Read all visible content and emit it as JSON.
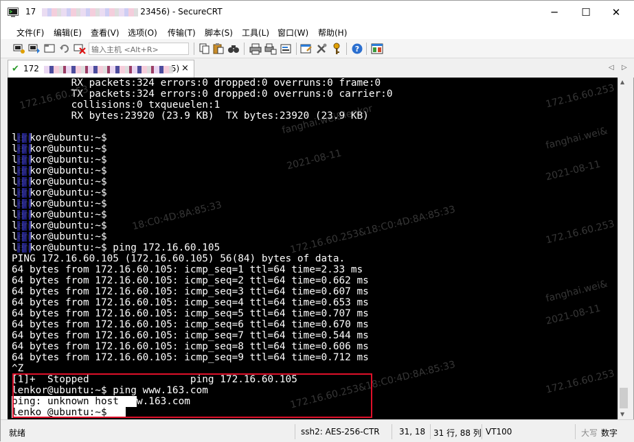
{
  "window": {
    "title_prefix": "17",
    "title_suffix": "23456) - SecureCRT",
    "minimize_glyph": "─",
    "maximize_glyph": "☐",
    "close_glyph": "✕"
  },
  "menu": [
    "文件(F)",
    "编辑(E)",
    "查看(V)",
    "选项(O)",
    "传输(T)",
    "脚本(S)",
    "工具(L)",
    "窗口(W)",
    "帮助(H)"
  ],
  "toolbar": {
    "host_placeholder": "输入主机 <Alt+R>",
    "icons": [
      "connect-icon",
      "quick-connect-icon",
      "connect-tab-icon",
      "reconnect-icon",
      "disconnect-icon",
      "copy-icon",
      "paste-icon",
      "find-icon",
      "print-icon",
      "print-setup-icon",
      "properties-icon",
      "global-options-icon",
      "keymap-icon",
      "help-icon",
      "sftp-icon"
    ]
  },
  "tab": {
    "label_prefix": "172",
    "label_suffix": "5)",
    "close_glyph": "×",
    "nav_left": "◁",
    "nav_right": "▷"
  },
  "terminal": {
    "lines": [
      "          RX packets:324 errors:0 dropped:0 overruns:0 frame:0",
      "          TX packets:324 errors:0 dropped:0 overruns:0 carrier:0",
      "          collisions:0 txqueuelen:1",
      "          RX bytes:23920 (23.9 KB)  TX bytes:23920 (23.9 KB)",
      "",
      "lenkor@ubuntu:~$",
      "lenkor@ubuntu:~$",
      "lenkor@ubuntu:~$",
      "lenkor@ubuntu:~$",
      "lenkor@ubuntu:~$",
      "lenkor@ubuntu:~$",
      "lenkor@ubuntu:~$",
      "lenkor@ubuntu:~$",
      "lenkor@ubuntu:~$",
      "lenkor@ubuntu:~$",
      "lenkor@ubuntu:~$ ping 172.16.60.105",
      "PING 172.16.60.105 (172.16.60.105) 56(84) bytes of data.",
      "64 bytes from 172.16.60.105: icmp_seq=1 ttl=64 time=2.33 ms",
      "64 bytes from 172.16.60.105: icmp_seq=2 ttl=64 time=0.662 ms",
      "64 bytes from 172.16.60.105: icmp_seq=3 ttl=64 time=0.607 ms",
      "64 bytes from 172.16.60.105: icmp_seq=4 ttl=64 time=0.653 ms",
      "64 bytes from 172.16.60.105: icmp_seq=5 ttl=64 time=0.707 ms",
      "64 bytes from 172.16.60.105: icmp_seq=6 ttl=64 time=0.670 ms",
      "64 bytes from 172.16.60.105: icmp_seq=7 ttl=64 time=0.544 ms",
      "64 bytes from 172.16.60.105: icmp_seq=8 ttl=64 time=0.606 ms",
      "64 bytes from 172.16.60.105: icmp_seq=9 ttl=64 time=0.712 ms",
      "^Z",
      "[1]+  Stopped                 ping 172.16.60.105",
      "lenkor@ubuntu:~$ ping www.163.com",
      "ping: unknown host www.163.com",
      "lenko @ubuntu:~$"
    ],
    "watermarks": [
      "172.16.60.253",
      "fanghai.wei&lenkor",
      "2021-08-11",
      "172.16.60.253",
      "fanghai.wei&",
      "2021-08-11",
      "18:C0:4D:8A:85:33",
      "172.16.60.253&18:C0:4D:8A:85:33",
      "172.16.60.253",
      "fanghai.wei&",
      "2021-08-11",
      "172.16.60.253&18:C0:4D:8A:85:33",
      "172.16.60.253"
    ]
  },
  "status": {
    "ready": "就绪",
    "cipher": "ssh2: AES-256-CTR",
    "cursor": "31,  18",
    "size": "31 行, 88 列",
    "emulation": "VT100",
    "caps": "大写",
    "num": "数字"
  }
}
